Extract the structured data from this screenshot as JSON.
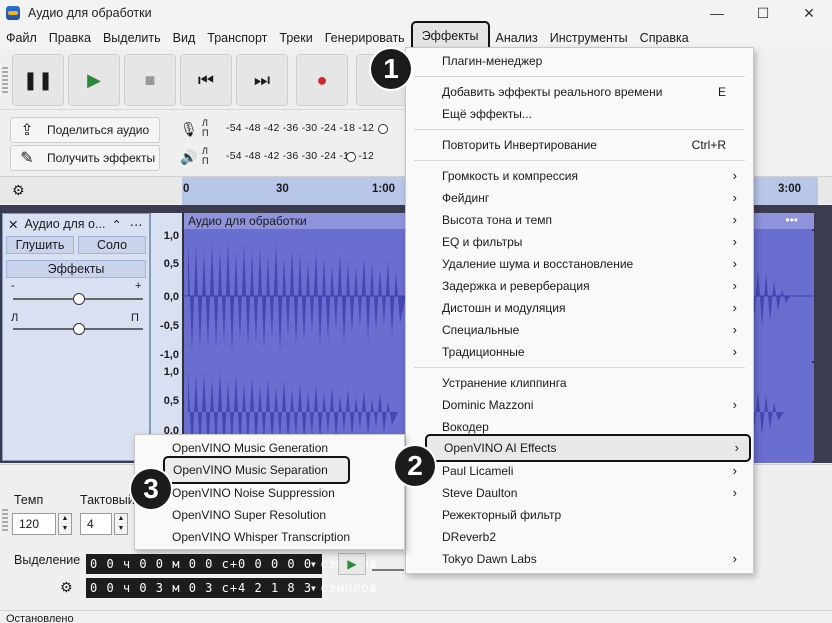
{
  "window": {
    "title": "Аудио для обработки",
    "controls": [
      "—",
      "☐",
      "✕"
    ]
  },
  "menubar": {
    "items": [
      "Файл",
      "Правка",
      "Выделить",
      "Вид",
      "Транспорт",
      "Треки",
      "Генерировать",
      "Эффекты",
      "Анализ",
      "Инструменты",
      "Справка"
    ],
    "active": "Эффекты"
  },
  "tools": {
    "share_label": "Поделиться аудио",
    "get_effects_label": "Получить эффекты",
    "meter_scale_1": "-54  -48  -42  -36  -30  -24  -18  -12",
    "meter_scale_2": "-54  -48  -42  -36  -30  -24  -18  -12",
    "meter_l": "Л",
    "meter_r": "П"
  },
  "timeline": {
    "ticks": [
      "0",
      "30",
      "1:00",
      "3:00"
    ]
  },
  "track": {
    "name": "Аудио для о...",
    "mute_label": "Глушить",
    "solo_label": "Соло",
    "effects_label": "Эффекты",
    "gain_minus": "-",
    "gain_plus": "+",
    "pan_left": "Л",
    "pan_right": "П",
    "clip_title": "Аудио для обработки",
    "scale_top": [
      "1,0",
      "0,5",
      "0,0",
      "-0,5",
      "-1,0"
    ],
    "scale_bottom": [
      "1,0",
      "0,5",
      "0,0"
    ]
  },
  "bottom": {
    "tempo_label": "Темп",
    "tempo_value": "120",
    "meter_label": "Тактовый",
    "meter_value": "4",
    "selection_label": "Выделение",
    "sel_start": "0 0 ч 0 0 м 0 0 с+0 0 0 0 0  сэмплов",
    "sel_end": "0 0 ч 0 3 м 0 3 с+4 2 1 8 3  сэмплов"
  },
  "status": "Остановлено",
  "effects_menu": {
    "plugin_manager": "Плагин-менеджер",
    "add_realtime": "Добавить эффекты реального времени",
    "add_realtime_shortcut": "E",
    "more_effects": "Ещё эффекты...",
    "repeat": "Повторить Инвертирование",
    "repeat_shortcut": "Ctrl+R",
    "groups": [
      "Громкость и компрессия",
      "Фейдинг",
      "Высота тона и темп",
      "EQ и фильтры",
      "Удаление шума и восстановление",
      "Задержка и реверберация",
      "Дистошн и модуляция",
      "Специальные",
      "Традиционные"
    ],
    "plugins": [
      "Устранение клиппинга",
      "Dominic Mazzoni",
      "Вокодер",
      "OpenVINO AI Effects",
      "Paul Licameli",
      "Steve Daulton",
      "Режекторный фильтр",
      "DReverb2",
      "Tokyo Dawn Labs"
    ]
  },
  "openvino_submenu": {
    "items": [
      "OpenVINO Music Generation",
      "OpenVINO Music Separation",
      "OpenVINO Noise Suppression",
      "OpenVINO Super Resolution",
      "OpenVINO Whisper Transcription"
    ],
    "highlighted": "OpenVINO Music Separation"
  },
  "badges": {
    "step1": "1",
    "step2": "2",
    "step3": "3"
  }
}
